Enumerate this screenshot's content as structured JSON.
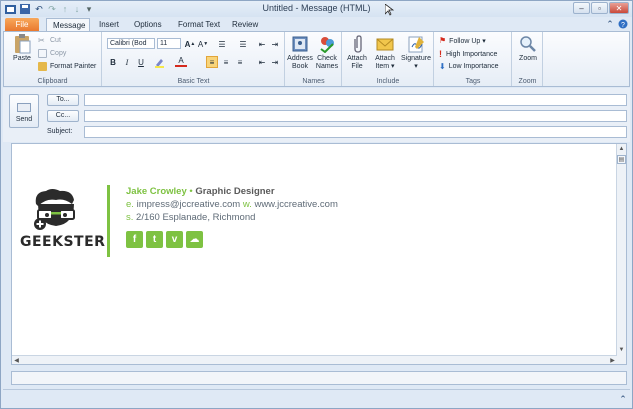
{
  "window": {
    "title": "Untitled - Message (HTML)"
  },
  "tabs": [
    {
      "label": "File"
    },
    {
      "label": "Message"
    },
    {
      "label": "Insert"
    },
    {
      "label": "Options"
    },
    {
      "label": "Format Text"
    },
    {
      "label": "Review"
    }
  ],
  "ribbon": {
    "clipboard": {
      "label": "Clipboard",
      "paste": "Paste",
      "cut": "Cut",
      "copy": "Copy",
      "format_painter": "Format Painter"
    },
    "basic_text": {
      "label": "Basic Text",
      "font": "Calibri (Bod",
      "size": "11"
    },
    "names": {
      "label": "Names",
      "address_book_1": "Address",
      "address_book_2": "Book",
      "check_names_1": "Check",
      "check_names_2": "Names"
    },
    "include": {
      "label": "Include",
      "attach_file_1": "Attach",
      "attach_file_2": "File",
      "attach_item_1": "Attach",
      "attach_item_2": "Item ▾",
      "signature_1": "Signature",
      "signature_2": "▾"
    },
    "tags": {
      "label": "Tags",
      "follow_up": "Follow Up ▾",
      "high_importance": "High Importance",
      "low_importance": "Low Importance"
    },
    "zoom": {
      "label": "Zoom",
      "zoom": "Zoom"
    }
  },
  "header": {
    "send": "Send",
    "to": "To...",
    "cc": "Cc...",
    "subject": "Subject:"
  },
  "signature": {
    "logo": "GEEKSTER",
    "name": "Jake Crowley",
    "separator": "•",
    "role": "Graphic Designer",
    "email_prefix": "e.",
    "email": "impress@jccreative.com",
    "web_prefix": "w.",
    "web": "www.jccreative.com",
    "address_prefix": "s.",
    "address": "2/160 Esplanade, Richmond",
    "social": [
      "f",
      "t",
      "v",
      "☁"
    ],
    "accent_color": "#7ec242"
  }
}
